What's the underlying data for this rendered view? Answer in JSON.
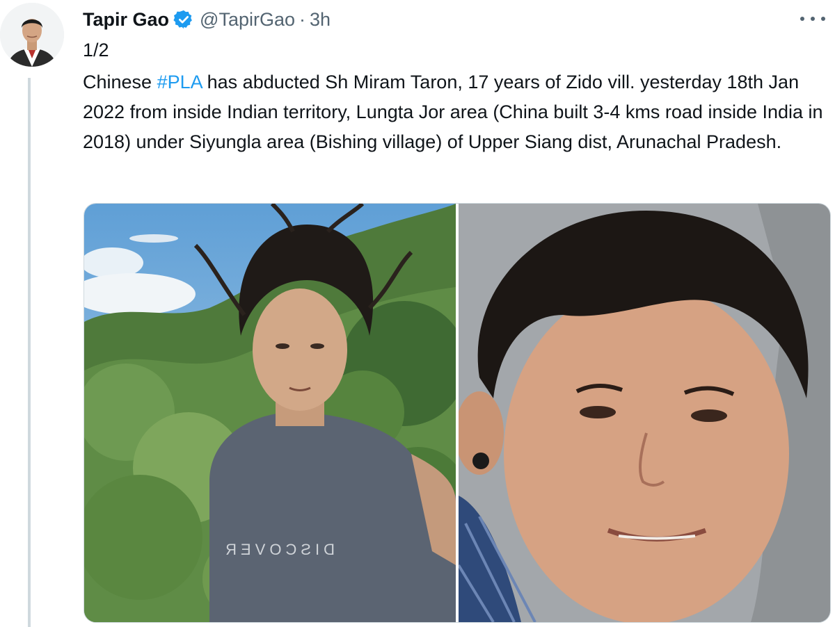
{
  "tweet": {
    "author_name": "Tapir Gao",
    "handle": "@TapirGao",
    "separator": "·",
    "time": "3h",
    "thread_count": "1/2",
    "text_prefix": "Chinese ",
    "hashtag": "#PLA",
    "text_suffix": " has abducted Sh Miram Taron, 17 years of Zido vill. yesterday 18th Jan 2022 from inside Indian territory, Lungta Jor area (China built 3-4 kms road inside India in 2018) under Siyungla area (Bishing village) of Upper Siang dist, Arunachal Pradesh."
  },
  "media": {
    "photo1_shirt_text": "DISCOVER"
  },
  "colors": {
    "link": "#1d9bf0",
    "verified": "#1d9bf0",
    "secondary_text": "#536471"
  },
  "icons": {
    "verified": "verified-badge-icon",
    "more": "more-options-icon"
  }
}
